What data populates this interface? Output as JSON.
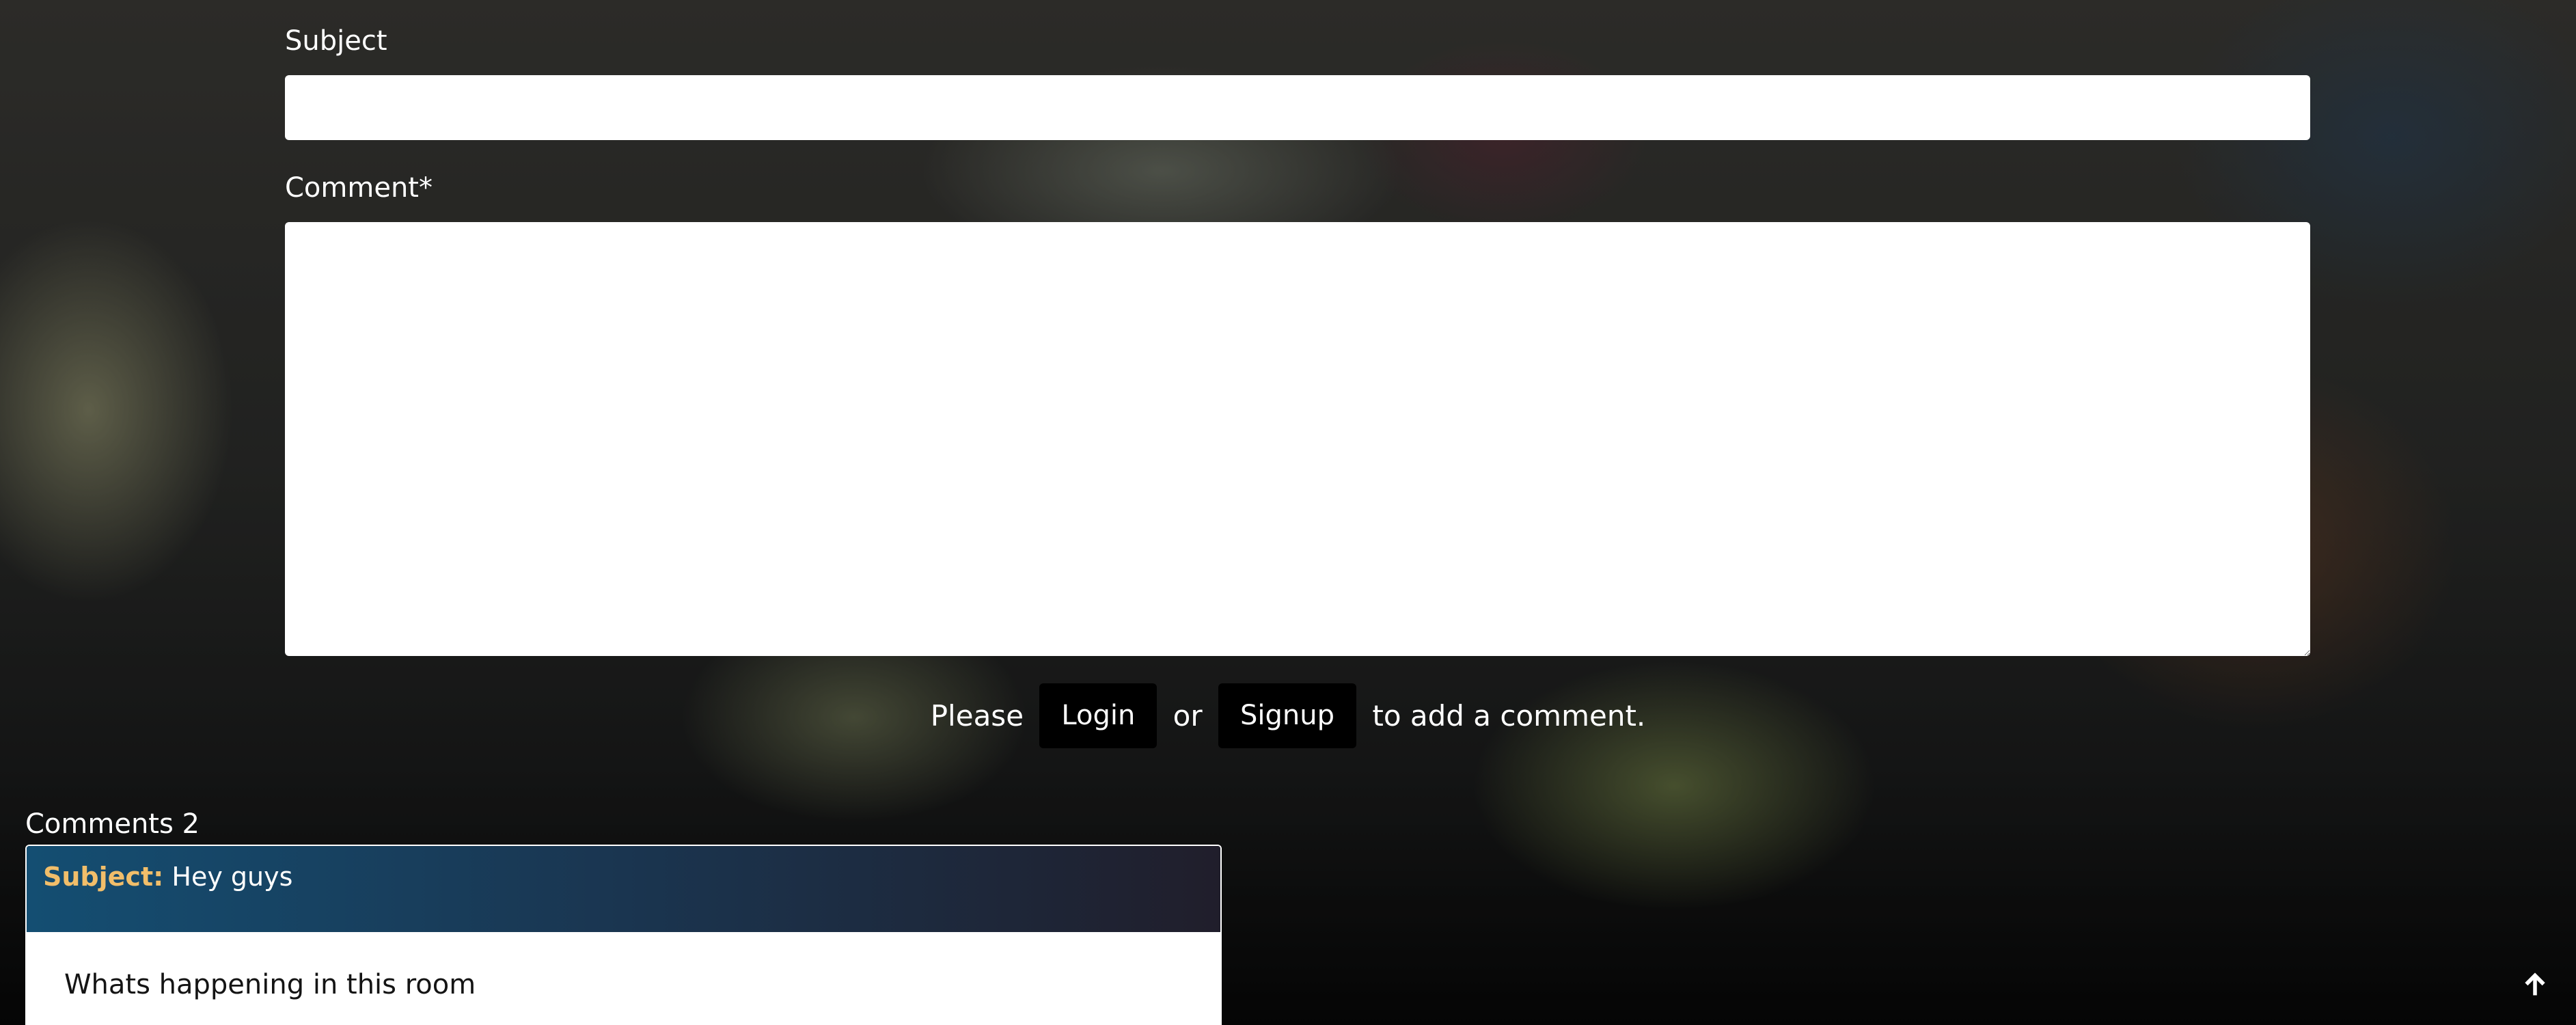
{
  "form": {
    "subject_label": "Subject",
    "comment_label": "Comment*",
    "subject_value": "",
    "comment_value": ""
  },
  "auth": {
    "prefix": "Please",
    "login_label": "Login",
    "middle": "or",
    "signup_label": "Signup",
    "suffix": "to add a comment."
  },
  "comments": {
    "heading": "Comments 2",
    "items": [
      {
        "subject_key": "Subject:",
        "subject": "Hey guys",
        "body": "Whats happening in this room"
      }
    ]
  },
  "icons": {
    "scroll_top": "arrow-up-icon"
  },
  "colors": {
    "subject_key": "#f1be6a",
    "header_gradient_start": "#144e72",
    "header_gradient_end": "#201e2b",
    "button_bg": "#000000"
  }
}
